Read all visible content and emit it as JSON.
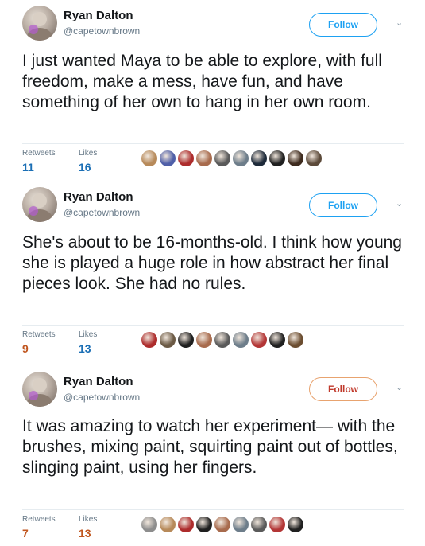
{
  "tweets": [
    {
      "name": "Ryan Dalton",
      "handle": "@capetownbrown",
      "follow_label": "Follow",
      "text": "I just wanted Maya to be able to explore, with full freedom, make a mess, have fun, and have something of her own to hang in her own room.",
      "retweets_label": "Retweets",
      "retweets": "11",
      "likes_label": "Likes",
      "likes": "16",
      "liker_colors": [
        "#b78a5a",
        "#4f5fa8",
        "#ad2c2c",
        "#a86b4d",
        "#5a5a5a",
        "#6d7d8a",
        "#1d2a3a",
        "#202020",
        "#3e2b1e",
        "#5c4a3a"
      ]
    },
    {
      "name": "Ryan Dalton",
      "handle": "@capetownbrown",
      "follow_label": "Follow",
      "text": "She's about to be 16-months-old. I think how young she is played a huge role in how abstract her final pieces look. She had no rules.",
      "retweets_label": "Retweets",
      "retweets": "9",
      "likes_label": "Likes",
      "likes": "13",
      "liker_colors": [
        "#ad2c2c",
        "#6b5a45",
        "#1f1f1f",
        "#a86b4d",
        "#5a5a5a",
        "#6d7d8a",
        "#b33636",
        "#202020",
        "#6b4d30"
      ]
    },
    {
      "name": "Ryan Dalton",
      "handle": "@capetownbrown",
      "follow_label": "Follow",
      "text": "It was amazing to watch her experiment— with the brushes, mixing paint, squirting paint out of bottles, slinging paint, using her fingers.",
      "retweets_label": "Retweets",
      "retweets": "7",
      "likes_label": "Likes",
      "likes": "13",
      "liker_colors": [
        "#8d8d8d",
        "#b78a5a",
        "#ad2c2c",
        "#1f1f1f",
        "#a86b4d",
        "#6d7d8a",
        "#5a5a5a",
        "#b33636",
        "#202020"
      ]
    }
  ],
  "colors": {
    "follow_blue": "#1da1f2",
    "follow_orange_border": "#e8a36f",
    "follow_orange_text": "#c0392b",
    "retweet_count_blue": "#1b6fb5",
    "retweet_count_orange": "#c0561f",
    "like_count_blue": "#1b6fb5",
    "like_count_orange": "#c0561f"
  },
  "icons": {
    "more": "chevron-down-icon"
  }
}
